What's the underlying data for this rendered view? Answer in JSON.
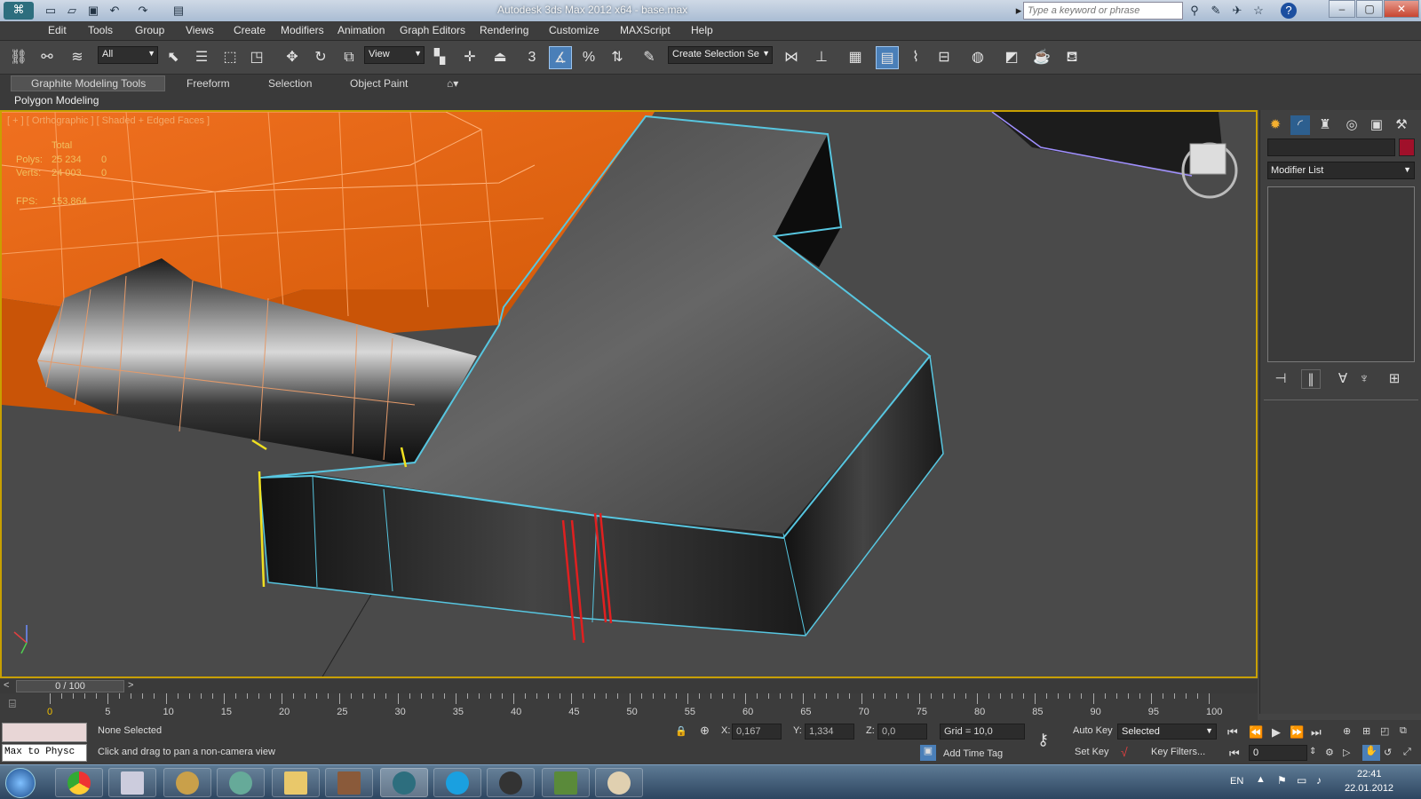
{
  "app": {
    "title": "Autodesk 3ds Max 2012 x64 - base.max"
  },
  "search": {
    "placeholder": "Type a keyword or phrase"
  },
  "menu": [
    "Edit",
    "Tools",
    "Group",
    "Views",
    "Create",
    "Modifiers",
    "Animation",
    "Graph Editors",
    "Rendering",
    "Customize",
    "MAXScript",
    "Help"
  ],
  "toolbar": {
    "filter": "All",
    "ref_coord": "View",
    "selection_set": "Create Selection Se",
    "snap3": "3",
    "snap_pct": "%"
  },
  "ribbon": {
    "tabs": [
      "Graphite Modeling Tools",
      "Freeform",
      "Selection",
      "Object Paint"
    ],
    "panel": "Polygon Modeling"
  },
  "viewport": {
    "label": "[ + ] [ Orthographic ] [ Shaded + Edged Faces ]",
    "stats": {
      "total": "Total",
      "polys_label": "Polys:",
      "polys": "25 234",
      "polys_sel": "0",
      "verts_label": "Verts:",
      "verts": "24 003",
      "verts_sel": "0",
      "fps_label": "FPS:",
      "fps": "153,864"
    }
  },
  "command_panel": {
    "modifier_list": "Modifier List"
  },
  "timeline": {
    "frame": "0 / 100",
    "ticks": [
      "0",
      "5",
      "10",
      "15",
      "20",
      "25",
      "30",
      "35",
      "40",
      "45",
      "50",
      "55",
      "60",
      "65",
      "70",
      "75",
      "80",
      "85",
      "90",
      "95",
      "100"
    ]
  },
  "status": {
    "script_listener": "Max to Physc",
    "selection": "None Selected",
    "prompt": "Click and drag to pan a non-camera view",
    "x_label": "X:",
    "x": "0,167",
    "y_label": "Y:",
    "y": "1,334",
    "z_label": "Z:",
    "z": "0,0",
    "grid": "Grid = 10,0",
    "add_time_tag": "Add Time Tag",
    "auto_key": "Auto Key",
    "set_key": "Set Key",
    "key_mode": "Selected",
    "key_filters": "Key Filters...",
    "frame_field": "0"
  },
  "taskbar": {
    "lang": "EN",
    "time": "22:41",
    "date": "22.01.2012"
  },
  "colors": {
    "accent": "#4a7fb8",
    "viewport_border": "#c8a000",
    "orange_mesh": "#e8650a",
    "selected_edges": "#57c6e0",
    "red_edges": "#e02020",
    "yellow_edges": "#f0e020"
  }
}
